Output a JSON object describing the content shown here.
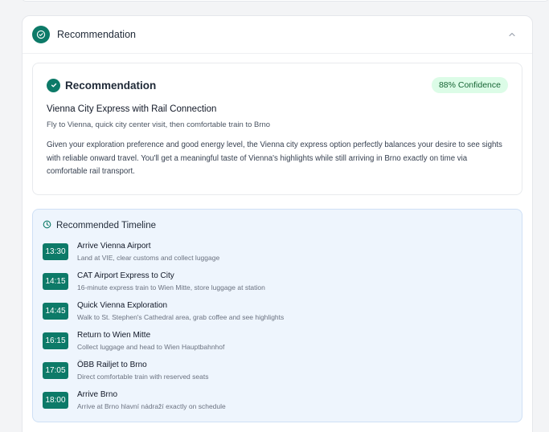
{
  "accordion": {
    "title": "Recommendation",
    "icon": "check-circle-icon",
    "toggle_icon": "chevron-up-icon"
  },
  "recommendation": {
    "title": "Recommendation",
    "confidence_badge": "88% Confidence",
    "option_title": "Vienna City Express with Rail Connection",
    "option_subtitle": "Fly to Vienna, quick city center visit, then comfortable train to Brno",
    "rationale": "Given your exploration preference and good energy level, the Vienna city express option perfectly balances your desire to see sights with reliable onward travel. You'll get a meaningful taste of Vienna's highlights while still arriving in Brno exactly on time via comfortable rail transport."
  },
  "timeline": {
    "title": "Recommended Timeline",
    "items": [
      {
        "time": "13:30",
        "title": "Arrive Vienna Airport",
        "desc": "Land at VIE, clear customs and collect luggage"
      },
      {
        "time": "14:15",
        "title": "CAT Airport Express to City",
        "desc": "16-minute express train to Wien Mitte, store luggage at station"
      },
      {
        "time": "14:45",
        "title": "Quick Vienna Exploration",
        "desc": "Walk to St. Stephen's Cathedral area, grab coffee and see highlights"
      },
      {
        "time": "16:15",
        "title": "Return to Wien Mitte",
        "desc": "Collect luggage and head to Wien Hauptbahnhof"
      },
      {
        "time": "17:05",
        "title": "ÖBB Railjet to Brno",
        "desc": "Direct comfortable train with reserved seats"
      },
      {
        "time": "18:00",
        "title": "Arrive Brno",
        "desc": "Arrive at Brno hlavní nádraží exactly on schedule"
      }
    ]
  },
  "colors": {
    "accent": "#0d7a68",
    "badge_bg": "#dcfce7",
    "badge_text": "#166534",
    "timeline_bg": "#eef5fd"
  }
}
